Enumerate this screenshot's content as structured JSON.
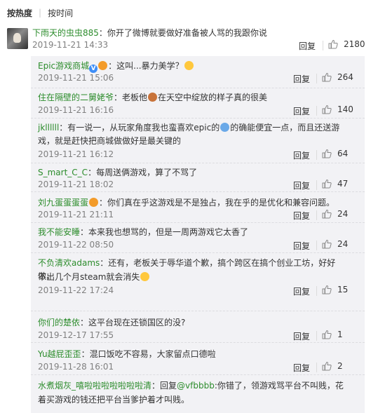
{
  "sort": {
    "hot": "按热度",
    "time": "按时间"
  },
  "main_comment": {
    "user": "下雨天的虫虫885",
    "text": "：你开了微博就要做好准备被人骂的我跟你说",
    "time": "2019-11-21 14:33",
    "reply": "回复",
    "likes": "2180"
  },
  "replies": [
    {
      "user": "Epic游戏商城",
      "text_a": "：这叫...暴力美学？",
      "time": "2019-11-21 15:06",
      "reply": "回复",
      "likes": "264"
    },
    {
      "user": "住在隔壁的二舅姥爷",
      "text_a": "：老板他",
      "text_b": "在天空中绽放的样子真的很美",
      "time": "2019-11-21 16:16",
      "reply": "回复",
      "likes": "140"
    },
    {
      "user": "jkllllll",
      "text_a": "：有一说一，从玩家角度我也蛮喜欢epic的",
      "text_b": "的确能便宜一点，而且还送游",
      "text_c": "戏，就是赶快把商城做做好是最关键的",
      "time": "2019-11-21 16:12",
      "reply": "回复",
      "likes": "64"
    },
    {
      "user": "S_mart_C_C",
      "text_a": "：每周送俩游戏，算了不骂了",
      "time": "2019-11-21 18:02",
      "reply": "回复",
      "likes": "47"
    },
    {
      "user": "刘九蛋蛋蛋蛋",
      "text_a": "：你们真在乎这游戏是不是独占，我在乎的是优化和兼容问题。",
      "time": "2019-11-21 21:11",
      "reply": "回复",
      "likes": "24"
    },
    {
      "user": "我不能安睡",
      "text_a": "：本来我也想骂的，但是一周两游戏它太香了",
      "time": "2019-11-22 08:50",
      "reply": "回复",
      "likes": "24"
    },
    {
      "user": "不负清欢adams",
      "text_a": "：还有，老板关于辱华道个歉，搞个跨区在搞个创业工坊，好好做，",
      "text_b": "不出几个月steam就会消失",
      "time": "2019-11-22 17:24",
      "reply": "回复",
      "likes": "15"
    },
    {
      "user": "你们的楚依",
      "text_a": "：这平台现在还锁国区的没?",
      "time": "2019-12-17 17:55",
      "reply": "回复",
      "likes": "1"
    },
    {
      "user": "Yu越屁歪歪",
      "text_a": "：混口饭吃不容易，大家留点口德啦",
      "time": "2019-11-28 16:01",
      "reply": "回复",
      "likes": "2"
    },
    {
      "user": "水煮烟灰_嘻啦啦啦啦啦啦啦清",
      "text_a": "：回复",
      "mention": "@vfbbbb",
      "text_b": ":你错了，领游戏骂平台不叫贱，花",
      "text_c": "着买游戏的钱还把平台当爹护着才叫贱。"
    }
  ],
  "colors": {
    "username": "#2c8c2c",
    "sub_bg": "#f2f2f5",
    "emoji": "#ffc83d"
  }
}
